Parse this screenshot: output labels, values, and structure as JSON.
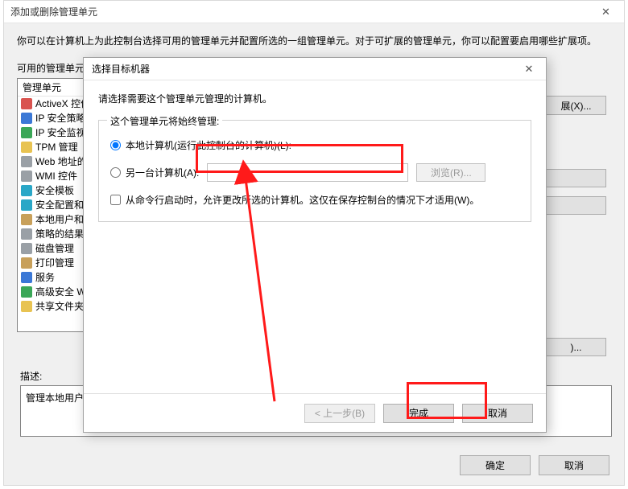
{
  "bg": {
    "title": "添加或删除管理单元",
    "close_glyph": "✕",
    "intro": "你可以在计算机上为此控制台选择可用的管理单元并配置所选的一组管理单元。对于可扩展的管理单元，你可以配置要启用哪些扩展项。",
    "avail_label": "可用的管理单元(",
    "col_header": "管理单元",
    "items": [
      "ActiveX 控件",
      "IP 安全策略",
      "IP 安全监视",
      "TPM 管理",
      "Web 地址的",
      "WMI 控件",
      "安全模板",
      "安全配置和分",
      "本地用户和组",
      "策略的结果",
      "磁盘管理",
      "打印管理",
      "服务",
      "高级安全 W",
      "共享文件夹"
    ],
    "btn_ext": "展(X)...",
    "btn_mid1": " ",
    "btn_mid2": " ",
    "btn_last": ")...",
    "desc_label": "描述:",
    "desc_text": "管理本地用户和",
    "btn_ok": "确定",
    "btn_cancel": "取消"
  },
  "wz": {
    "title": "选择目标机器",
    "close_glyph": "✕",
    "instruction": "请选择需要这个管理单元管理的计算机。",
    "group_title": "这个管理单元将始终管理:",
    "radio_local": "本地计算机(运行此控制台的计算机)(L):",
    "radio_other": "另一台计算机(A):",
    "other_value": "",
    "browse": "浏览(R)...",
    "checkbox_label": "从命令行启动时，允许更改所选的计算机。这仅在保存控制台的情况下才适用(W)。",
    "btn_back": "< 上一步(B)",
    "btn_finish": "完成",
    "btn_cancel": "取消"
  }
}
